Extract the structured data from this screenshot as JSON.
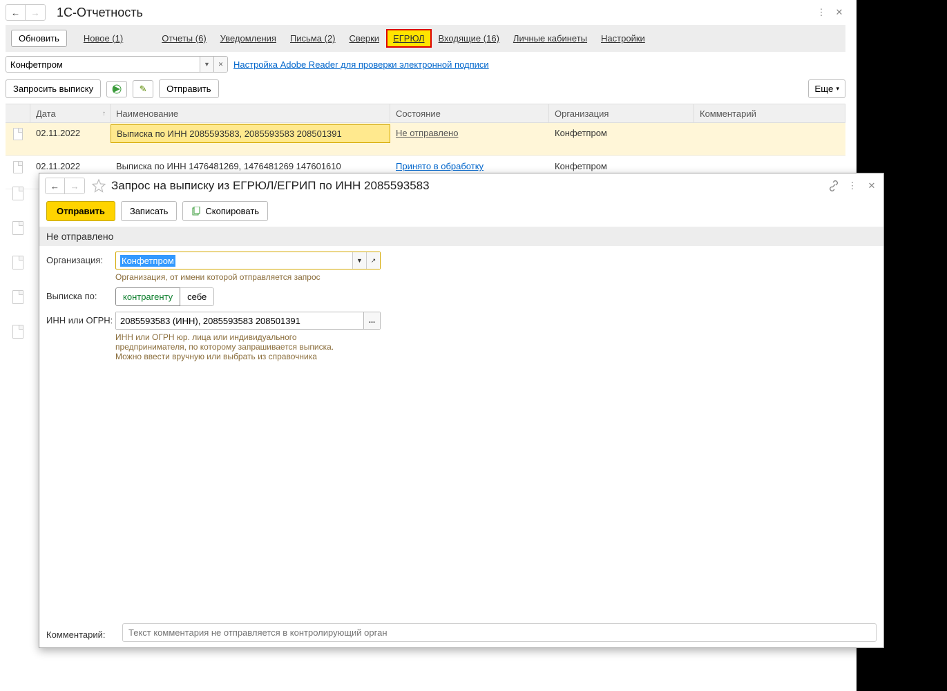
{
  "header": {
    "title": "1С-Отчетность"
  },
  "toolbar": {
    "refresh": "Обновить",
    "new": "Новое (1)",
    "tabs": {
      "reports": "Отчеты (6)",
      "notifications": "Уведомления",
      "letters": "Письма (2)",
      "reconciliations": "Сверки",
      "egrul": "ЕГРЮЛ",
      "incoming": "Входящие (16)",
      "cabinets": "Личные кабинеты",
      "settings": "Настройки"
    }
  },
  "filter": {
    "org_value": "Конфетпром",
    "adobe_link": "Настройка Adobe Reader для проверки электронной подписи"
  },
  "actions": {
    "request": "Запросить выписку",
    "send": "Отправить",
    "more": "Еще"
  },
  "columns": {
    "date": "Дата",
    "name": "Наименование",
    "state": "Состояние",
    "org": "Организация",
    "comment": "Комментарий"
  },
  "rows": [
    {
      "date": "02.11.2022",
      "name": "Выписка по ИНН 2085593583, 2085593583 208501391",
      "state": "Не отправлено",
      "org": "Конфетпром",
      "selected": true,
      "state_class": ""
    },
    {
      "date": "02.11.2022",
      "name": "Выписка по ИНН 1476481269, 1476481269 147601610",
      "state": "Принято в обработку",
      "org": "Конфетпром",
      "selected": false,
      "state_class": "blue"
    }
  ],
  "popup": {
    "title": "Запрос на выписку из ЕГРЮЛ/ЕГРИП по ИНН 2085593583",
    "send": "Отправить",
    "save": "Записать",
    "copy": "Скопировать",
    "status": "Не отправлено",
    "org_label": "Организация:",
    "org_value": "Конфетпром",
    "org_hint": "Организация, от имени которой отправляется запрос",
    "by_label": "Выписка по:",
    "by_contractor": "контрагенту",
    "by_self": "себе",
    "inn_label": "ИНН или ОГРН:",
    "inn_value": "2085593583 (ИНН), 2085593583 208501391",
    "inn_hint1": "ИНН или ОГРН юр. лица или индивидуального",
    "inn_hint2": "предпринимателя, по которому запрашивается выписка.",
    "inn_hint3": "Можно ввести вручную или выбрать из справочника",
    "comment_label": "Комментарий:",
    "comment_placeholder": "Текст комментария не отправляется в контролирующий орган"
  }
}
